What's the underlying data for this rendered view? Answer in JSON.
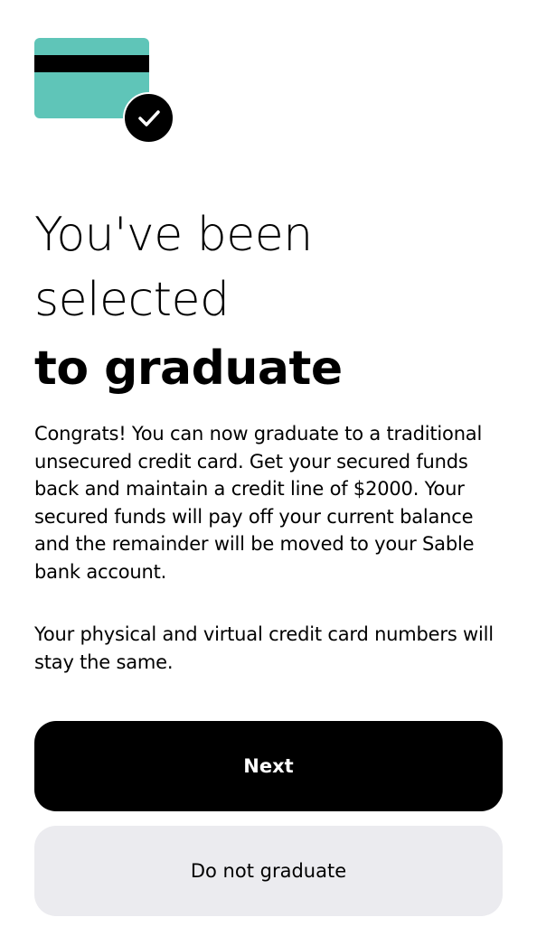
{
  "colors": {
    "card_teal": "#5fc5b8",
    "card_stripe": "#000000",
    "badge_bg": "#000000",
    "primary_button_bg": "#000000",
    "primary_button_text": "#ffffff",
    "secondary_button_bg": "#ebebef",
    "secondary_button_text": "#000000"
  },
  "icons": {
    "illustration": "credit-card-icon",
    "badge": "check-icon"
  },
  "headline": {
    "line1": "You've been",
    "line2": "selected",
    "line3": "to graduate"
  },
  "body": {
    "paragraph1": "Congrats! You can now graduate to a traditional unsecured credit card. Get your secured funds back and maintain a credit line of $2000. Your secured funds will pay off your current balance and the remainder will be moved to your Sable bank account.",
    "paragraph2": "Your physical and virtual credit card numbers will stay the same."
  },
  "actions": {
    "next_label": "Next",
    "decline_label": "Do not graduate"
  }
}
